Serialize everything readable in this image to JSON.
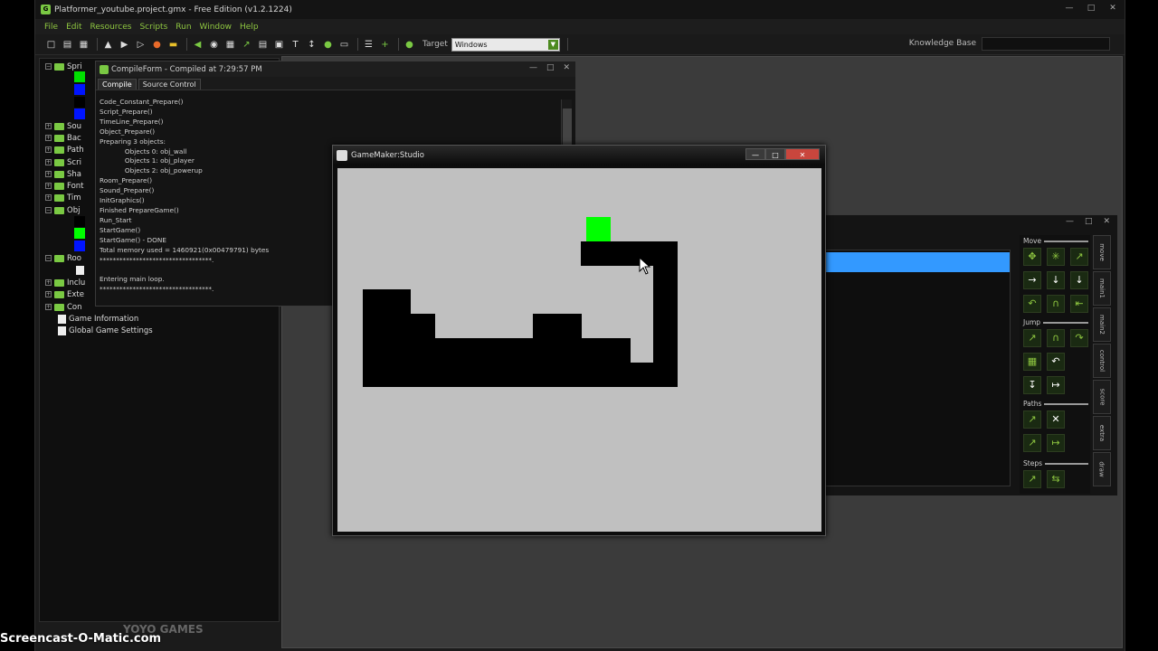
{
  "titlebar": {
    "title": "Platformer_youtube.project.gmx  -  Free Edition (v1.2.1224)",
    "logo": "gm-logo-icon"
  },
  "menu": [
    "File",
    "Edit",
    "Resources",
    "Scripts",
    "Run",
    "Window",
    "Help"
  ],
  "toolbar": {
    "target_label": "Target",
    "target_value": "Windows",
    "knowledge_base_label": "Knowledge Base"
  },
  "tree": {
    "items": [
      {
        "label": "Spri",
        "folder": true
      },
      {
        "label": "Sou",
        "folder": true
      },
      {
        "label": "Bac",
        "folder": true
      },
      {
        "label": "Path",
        "folder": true
      },
      {
        "label": "Scri",
        "folder": true
      },
      {
        "label": "Sha",
        "folder": true
      },
      {
        "label": "Font",
        "folder": true
      },
      {
        "label": "Tim",
        "folder": true
      },
      {
        "label": "Obj",
        "folder": true
      },
      {
        "label": "Roo",
        "folder": true
      },
      {
        "label": "Inclu",
        "folder": true
      },
      {
        "label": "Exte",
        "folder": true
      },
      {
        "label": "Con",
        "folder": true
      },
      {
        "label": "Game Information",
        "folder": false
      },
      {
        "label": "Global Game Settings",
        "folder": false
      }
    ]
  },
  "compile_form": {
    "title": "CompileForm - Compiled at 7:29:57 PM",
    "tabs": [
      "Compile",
      "Source Control"
    ],
    "log": [
      "Code_Constant_Prepare()",
      "Script_Prepare()",
      "TimeLine_Prepare()",
      "Object_Prepare()",
      "Preparing 3 objects:",
      "            Objects 0: obj_wall",
      "            Objects 1: obj_player",
      "            Objects 2: obj_powerup",
      "Room_Prepare()",
      "Sound_Prepare()",
      "InitGraphics()",
      "Finished PrepareGame()",
      "Run_Start",
      "StartGame()",
      "StartGame() - DONE",
      "Total memory used = 1460921(0x00479791) bytes",
      "**********************************.",
      "",
      "Entering main loop.",
      "**********************************."
    ]
  },
  "game_window": {
    "title": "GameMaker:Studio",
    "colors": {
      "background": "#c0c0c0",
      "wall": "#000000",
      "player": "#00ff00"
    }
  },
  "action_panel": {
    "sections": [
      "Move",
      "Jump",
      "Paths",
      "Steps"
    ],
    "tabs": [
      "move",
      "main1",
      "main2",
      "control",
      "score",
      "extra",
      "draw"
    ]
  },
  "watermark": {
    "text": "Screencast-O-Matic.com",
    "brand": "YOYO GAMES"
  }
}
